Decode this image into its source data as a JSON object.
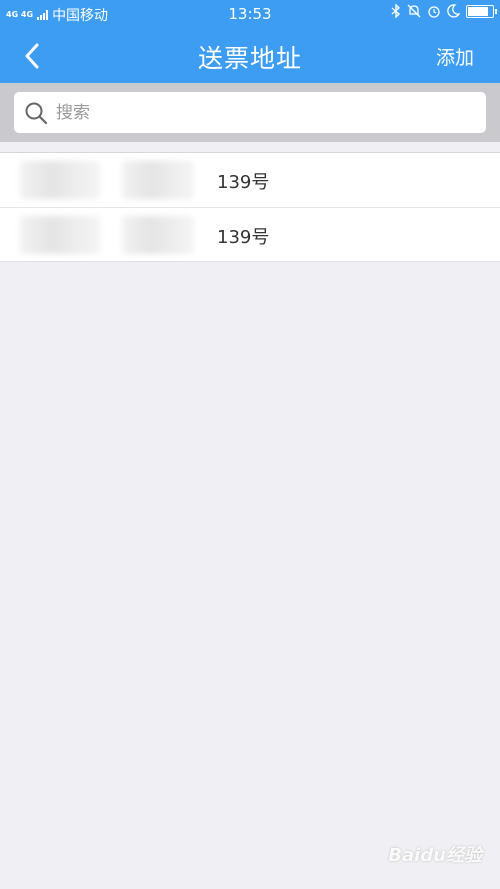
{
  "status_bar": {
    "network": "4G 4G",
    "carrier": "中国移动",
    "time": "13:53",
    "battery_level": 0.85
  },
  "nav": {
    "title": "送票地址",
    "add_label": "添加"
  },
  "search": {
    "placeholder": "搜索"
  },
  "addresses": [
    {
      "number": "139号"
    },
    {
      "number": "139号"
    }
  ],
  "watermark": "Baidu经验",
  "colors": {
    "accent": "#3d9df3",
    "background": "#efeff4",
    "search_band": "#c9c9ce"
  }
}
